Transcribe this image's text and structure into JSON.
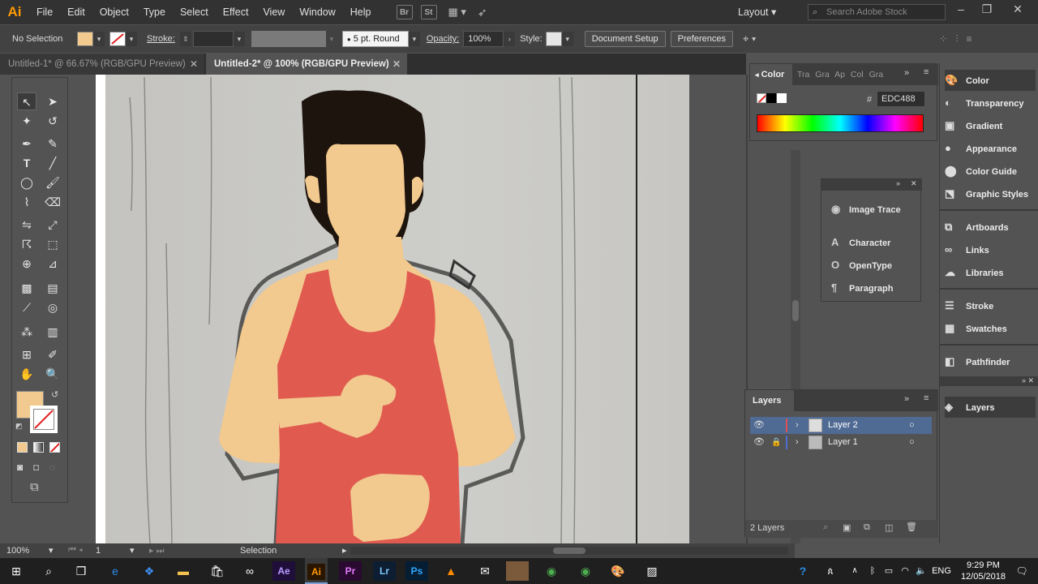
{
  "app": {
    "logo": "Ai"
  },
  "menu": [
    "File",
    "Edit",
    "Object",
    "Type",
    "Select",
    "Effect",
    "View",
    "Window",
    "Help"
  ],
  "menubar_icons": [
    "Br",
    "St"
  ],
  "workspace": {
    "label": "Layout",
    "search_placeholder": "Search Adobe Stock"
  },
  "control_bar": {
    "selection": "No Selection",
    "stroke_label": "Stroke:",
    "brush": "5 pt. Round",
    "opacity_label": "Opacity:",
    "opacity_value": "100%",
    "style_label": "Style:",
    "document_setup": "Document Setup",
    "preferences": "Preferences",
    "fill_color": "#F2C98E"
  },
  "tabs": [
    {
      "label": "Untitled-1* @ 66.67% (RGB/GPU Preview)",
      "active": false
    },
    {
      "label": "Untitled-2* @ 100% (RGB/GPU Preview)",
      "active": true
    }
  ],
  "color_panel": {
    "title": "Color",
    "other_tabs": [
      "Tra",
      "Gra",
      "Ap",
      "Col",
      "Gra"
    ],
    "hex_label": "#",
    "hex_value": "EDC488"
  },
  "type_panel": {
    "items": [
      "Image Trace",
      "Character",
      "OpenType",
      "Paragraph"
    ]
  },
  "layers_panel": {
    "title": "Layers",
    "layers": [
      {
        "name": "Layer 2",
        "color": "#e05050",
        "selected": true
      },
      {
        "name": "Layer 1",
        "color": "#4f6fd0",
        "selected": false
      }
    ],
    "count": "2 Layers"
  },
  "dock": {
    "group1": [
      "Color",
      "Transparency",
      "Gradient",
      "Appearance",
      "Color Guide",
      "Graphic Styles"
    ],
    "group2": [
      "Artboards",
      "Links",
      "Libraries"
    ],
    "group3": [
      "Stroke",
      "Swatches"
    ],
    "group4": [
      "Pathfinder"
    ],
    "group5": [
      "Layers"
    ]
  },
  "status": {
    "zoom": "100%",
    "artboard": "1",
    "tool": "Selection"
  },
  "taskbar": {
    "apps": [
      "Ae",
      "Ai",
      "Pr",
      "Lr",
      "Ps"
    ],
    "time": "9:29 PM",
    "date": "12/05/2018",
    "lang": "ENG"
  }
}
